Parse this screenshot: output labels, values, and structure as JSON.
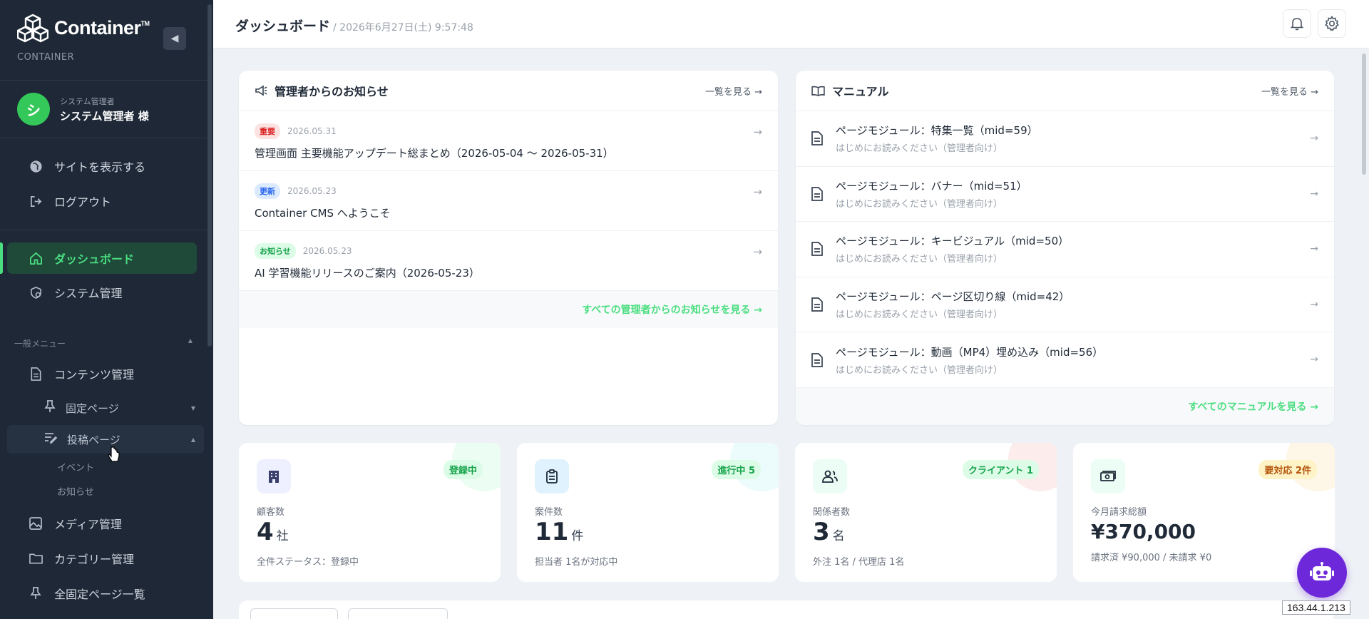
{
  "brand": {
    "name": "Container",
    "tm": "TM",
    "sub": "CONTAINER"
  },
  "user": {
    "initial": "シ",
    "role": "システム管理者",
    "name": "システム管理者 様"
  },
  "sidebar": {
    "top_links": [
      {
        "label": "サイトを表示する",
        "icon": "globe-icon"
      },
      {
        "label": "ログアウト",
        "icon": "logout-icon"
      }
    ],
    "main": [
      {
        "label": "ダッシュボード",
        "icon": "home-icon",
        "active": true
      },
      {
        "label": "システム管理",
        "icon": "gear-shield-icon"
      }
    ],
    "section_label": "一般メニュー",
    "content": {
      "label": "コンテンツ管理",
      "icon": "document-icon"
    },
    "sub": [
      {
        "label": "固定ページ",
        "icon": "pin-icon"
      },
      {
        "label": "投稿ページ",
        "icon": "edit-list-icon",
        "open": true
      }
    ],
    "leaves": [
      "イベント",
      "お知らせ"
    ],
    "bottom": [
      {
        "label": "メディア管理",
        "icon": "image-icon"
      },
      {
        "label": "カテゴリー管理",
        "icon": "folder-icon"
      },
      {
        "label": "全固定ページ一覧",
        "icon": "pin-icon"
      }
    ]
  },
  "header": {
    "title": "ダッシュボード",
    "datetime": "/ 2026年6月27日(土) 9:57:48"
  },
  "notices": {
    "title": "管理者からのお知らせ",
    "see_all": "一覧を見る →",
    "items": [
      {
        "badge": "重要",
        "badge_color": "#dc2626",
        "date": "2026.05.31",
        "title": "管理画面 主要機能アップデート総まとめ（2026-05-04 〜 2026-05-31）"
      },
      {
        "badge": "更新",
        "badge_color": "#2563eb",
        "date": "2026.05.23",
        "title": "Container CMS へようこそ"
      },
      {
        "badge": "お知らせ",
        "badge_color": "#16a34a",
        "date": "2026.05.23",
        "title": "AI 学習機能リリースのご案内（2026-05-23）"
      }
    ],
    "footer": "すべての管理者からのお知らせを見る →"
  },
  "manual": {
    "title": "マニュアル",
    "see_all": "一覧を見る →",
    "items": [
      {
        "title": "ページモジュール：特集一覧（mid=59）",
        "sub": "はじめにお読みください（管理者向け）"
      },
      {
        "title": "ページモジュール：バナー（mid=51）",
        "sub": "はじめにお読みください（管理者向け）"
      },
      {
        "title": "ページモジュール：キービジュアル（mid=50）",
        "sub": "はじめにお読みください（管理者向け）"
      },
      {
        "title": "ページモジュール：ページ区切り線（mid=42）",
        "sub": "はじめにお読みください（管理者向け）"
      },
      {
        "title": "ページモジュール：動画（MP4）埋め込み（mid=56）",
        "sub": "はじめにお読みください（管理者向け）"
      }
    ],
    "footer": "すべてのマニュアルを見る →"
  },
  "stats": [
    {
      "label": "顧客数",
      "value": "4",
      "unit": "社",
      "badge": "登録中",
      "note": "全件ステータス：登録中",
      "icon": "building-icon"
    },
    {
      "label": "案件数",
      "value": "11",
      "unit": "件",
      "badge": "進行中 5",
      "note": "担当者 1名が対応中",
      "icon": "clipboard-icon"
    },
    {
      "label": "関係者数",
      "value": "3",
      "unit": "名",
      "badge": "クライアント 1",
      "note": "外注 1名 / 代理店 1名",
      "icon": "people-icon"
    },
    {
      "label": "今月請求総額",
      "value": "¥370,000",
      "unit": "",
      "badge": "要対応 2件",
      "note": "請求済 ¥90,000 / 未請求 ¥0",
      "icon": "money-icon"
    }
  ],
  "ip": "163.44.1.213",
  "colors": {
    "accent": "#4ade80",
    "sidebar_bg": "#1e2836",
    "bot": "#6d28d9"
  }
}
